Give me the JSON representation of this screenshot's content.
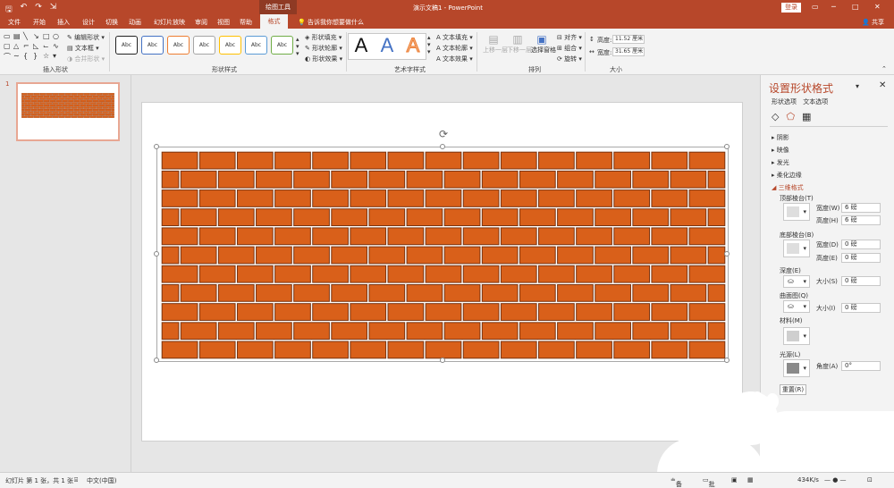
{
  "qat": {
    "save_icon": "save-icon",
    "undo_icon": "undo-icon",
    "redo_icon": "redo-icon"
  },
  "titlebar": {
    "context_tools": "绘图工具",
    "doc_title": "演示文稿1 - PowerPoint",
    "login": "登录"
  },
  "menu": {
    "tabs": [
      "文件",
      "开始",
      "插入",
      "设计",
      "切换",
      "动画",
      "幻灯片放映",
      "审阅",
      "视图",
      "帮助"
    ],
    "active_tab": "格式",
    "tell_me": "告诉我你想要做什么",
    "share": "共享"
  },
  "ribbon": {
    "insert_shapes": {
      "edit_shape": "编辑形状",
      "text_box": "文本框",
      "merge_shapes": "合并形状",
      "label": "插入形状"
    },
    "shape_styles": {
      "swatch": "Abc",
      "fill": "形状填充",
      "outline": "形状轮廓",
      "effects": "形状效果",
      "label": "形状样式"
    },
    "wordart": {
      "letter": "A",
      "text_fill": "文本填充",
      "text_outline": "文本轮廓",
      "text_effects": "文本效果",
      "label": "艺术字样式"
    },
    "arrange": {
      "bring_forward": "上移一层",
      "send_backward": "下移一层",
      "selection_pane": "选择窗格",
      "align": "对齐",
      "group": "组合",
      "rotate": "旋转",
      "label": "排列"
    },
    "size": {
      "height_label": "高度:",
      "height": "11.52 厘米",
      "width_label": "宽度:",
      "width": "31.65 厘米",
      "label": "大小"
    }
  },
  "thumbnails": {
    "slide_number": "1"
  },
  "pane": {
    "title": "设置形状格式",
    "tabs": [
      "形状选项",
      "文本选项"
    ],
    "sections": {
      "shadow": "阴影",
      "reflection": "映像",
      "glow": "发光",
      "soft_edges": "柔化边缘",
      "format_3d": "三维格式"
    },
    "top_bevel": "顶部棱台(T)",
    "bottom_bevel": "底部棱台(B)",
    "width_label": "宽度(W)",
    "height_label": "高度(H)",
    "width_label_b": "宽度(D)",
    "height_label_b": "高度(E)",
    "top_width": "6 磅",
    "top_height": "6 磅",
    "bottom_width": "0 磅",
    "bottom_height": "0 磅",
    "depth": "深度(E)",
    "depth_size_label": "大小(S)",
    "depth_size": "0 磅",
    "contour": "曲面图(Q)",
    "contour_size_label": "大小(I)",
    "contour_size": "0 磅",
    "material": "材料(M)",
    "lighting": "光源(L)",
    "angle_label": "角度(A)",
    "angle": "0°",
    "reset": "重置(R)"
  },
  "status": {
    "slide_info": "幻灯片 第 1 张，共 1 张",
    "language": "中文(中国)",
    "notes": "备注",
    "comments": "批注",
    "speed": "434K/s"
  },
  "colors": {
    "accent": "#b7472a",
    "brick": "#d9601a",
    "brick_dark": "#7a3410"
  }
}
